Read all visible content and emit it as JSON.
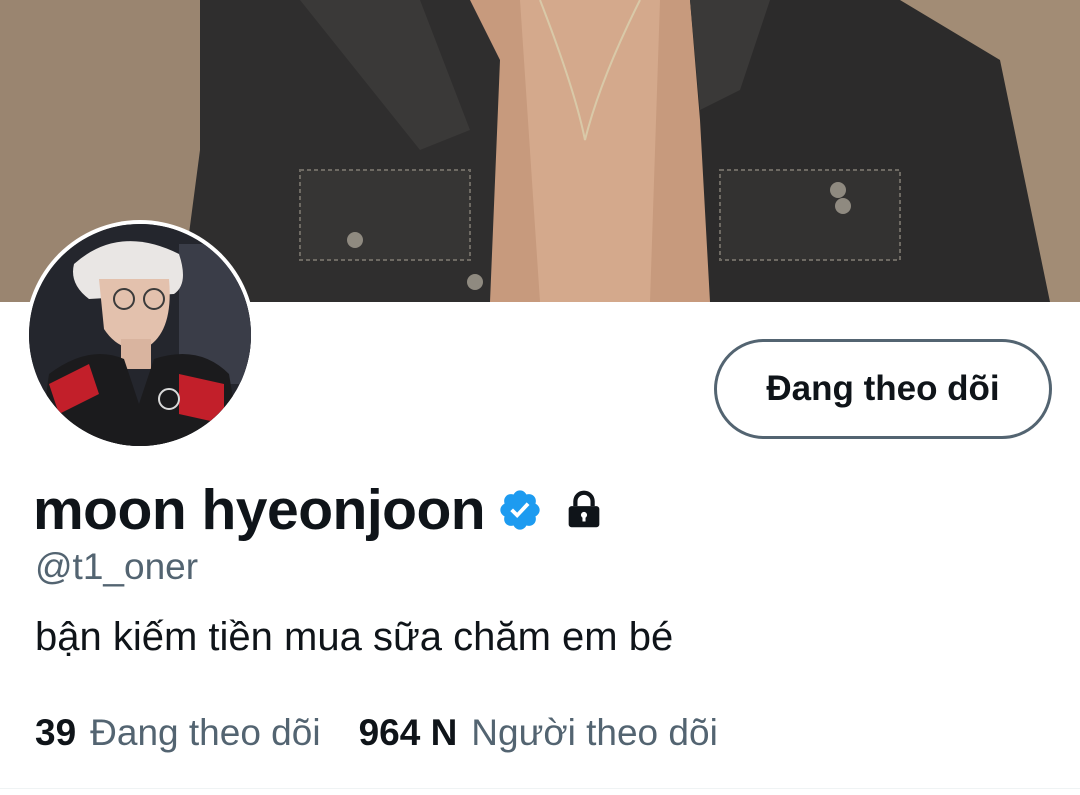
{
  "header": {
    "banner_image": "profile-header-photo"
  },
  "profile": {
    "avatar_image": "profile-avatar-photo",
    "display_name": "moon hyeonjoon",
    "verified": true,
    "protected": true,
    "handle": "@t1_oner",
    "bio": "bận kiếm tiền mua sữa chăm em bé"
  },
  "actions": {
    "follow_button_label": "Đang theo dõi"
  },
  "stats": {
    "following_count": "39",
    "following_label": "Đang theo dõi",
    "followers_count": "964 N",
    "followers_label": "Người theo dõi"
  },
  "icons": {
    "verified": "verified-badge-icon",
    "lock": "lock-icon"
  },
  "colors": {
    "verified_blue": "#1d9bf0",
    "text_primary": "#0f1419",
    "text_secondary": "#536471"
  }
}
